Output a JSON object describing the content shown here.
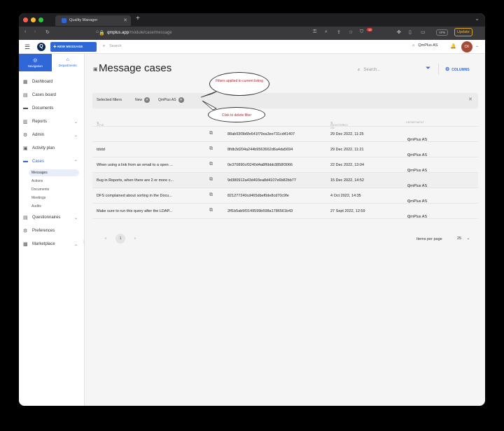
{
  "browser": {
    "tab_title": "Quality Manager",
    "url_host": "qmplus.app",
    "url_path": "/module/case/message",
    "badge_count": "10",
    "vpn_label": "VPN",
    "update_label": "Update"
  },
  "header": {
    "logo_letter": "Q",
    "new_message_label": "NEW MESSAGE",
    "search_placeholder": "Search",
    "company": "QmPlus AS",
    "avatar_initials": "CK"
  },
  "sidebar": {
    "tab_navigation": "Navigation",
    "tab_departments": "Departments",
    "items": [
      {
        "label": "Dashboard",
        "icon": "dashboard-icon"
      },
      {
        "label": "Cases board",
        "icon": "board-icon"
      },
      {
        "label": "Documents",
        "icon": "folder-icon"
      },
      {
        "label": "Reports",
        "icon": "chart-icon"
      },
      {
        "label": "Admin",
        "icon": "admin-icon"
      },
      {
        "label": "Activity plan",
        "icon": "calendar-icon"
      },
      {
        "label": "Cases",
        "icon": "folder-icon"
      },
      {
        "label": "Questionnaires",
        "icon": "questionnaire-icon"
      },
      {
        "label": "Preferences",
        "icon": "gear-icon"
      },
      {
        "label": "Marketplace",
        "icon": "store-icon"
      }
    ],
    "cases_sub": [
      "Messages",
      "Actions",
      "Documents",
      "Meetings",
      "Audits"
    ]
  },
  "main": {
    "title": "Message cases",
    "search_placeholder": "Search...",
    "columns_label": "COLUMNS",
    "filters_label": "Selected filters",
    "filter_chips": [
      "New",
      "QmPlus AS"
    ],
    "callout_filters": "Filters applied to current listing",
    "callout_delete": "Click to delete filter",
    "table": {
      "headers": [
        "TITLE",
        "",
        "REGISTERED ON",
        "DEPARTMENT"
      ],
      "rows": [
        {
          "title": "",
          "id": "88ab93f3b6fe641f79ea3ee731cd41407",
          "date": "29 Dec 2022, 11:25",
          "dept": "QmPlus AS"
        },
        {
          "title": "tdstd",
          "id": "8fdb3d204a244b9563662d6a4da5694",
          "date": "29 Dec 2022, 11:21",
          "dept": "QmPlus AS"
        },
        {
          "title": "When using a link from an email to a open ...",
          "id": "0e370890cf0240d4a8f6bbb3858f3066",
          "date": "22 Dec 2022, 13:04",
          "dept": "QmPlus AS"
        },
        {
          "title": "Bug in Reports, when there are 2 or more c...",
          "id": "9d380912a43d493ea8d4107e6b82bb77",
          "date": "15 Dec 2022, 14:52",
          "dept": "QmPlus AS"
        },
        {
          "title": "DFS complained about sorting in the Docu...",
          "id": "821277240cd465dbef0de8cd70c9fe",
          "date": "4 Oct 2022, 14:35",
          "dept": "QmPlus AS"
        },
        {
          "title": "Make sure to run this query after the LDAP...",
          "id": "2ff1b5ab9f3149599b598a1786561b43",
          "date": "27 Sept 2022, 12:59",
          "dept": "QmPlus AS"
        }
      ]
    },
    "pagination": {
      "current_page": "1",
      "items_per_page_label": "Items per page",
      "items_per_page": "25"
    }
  }
}
